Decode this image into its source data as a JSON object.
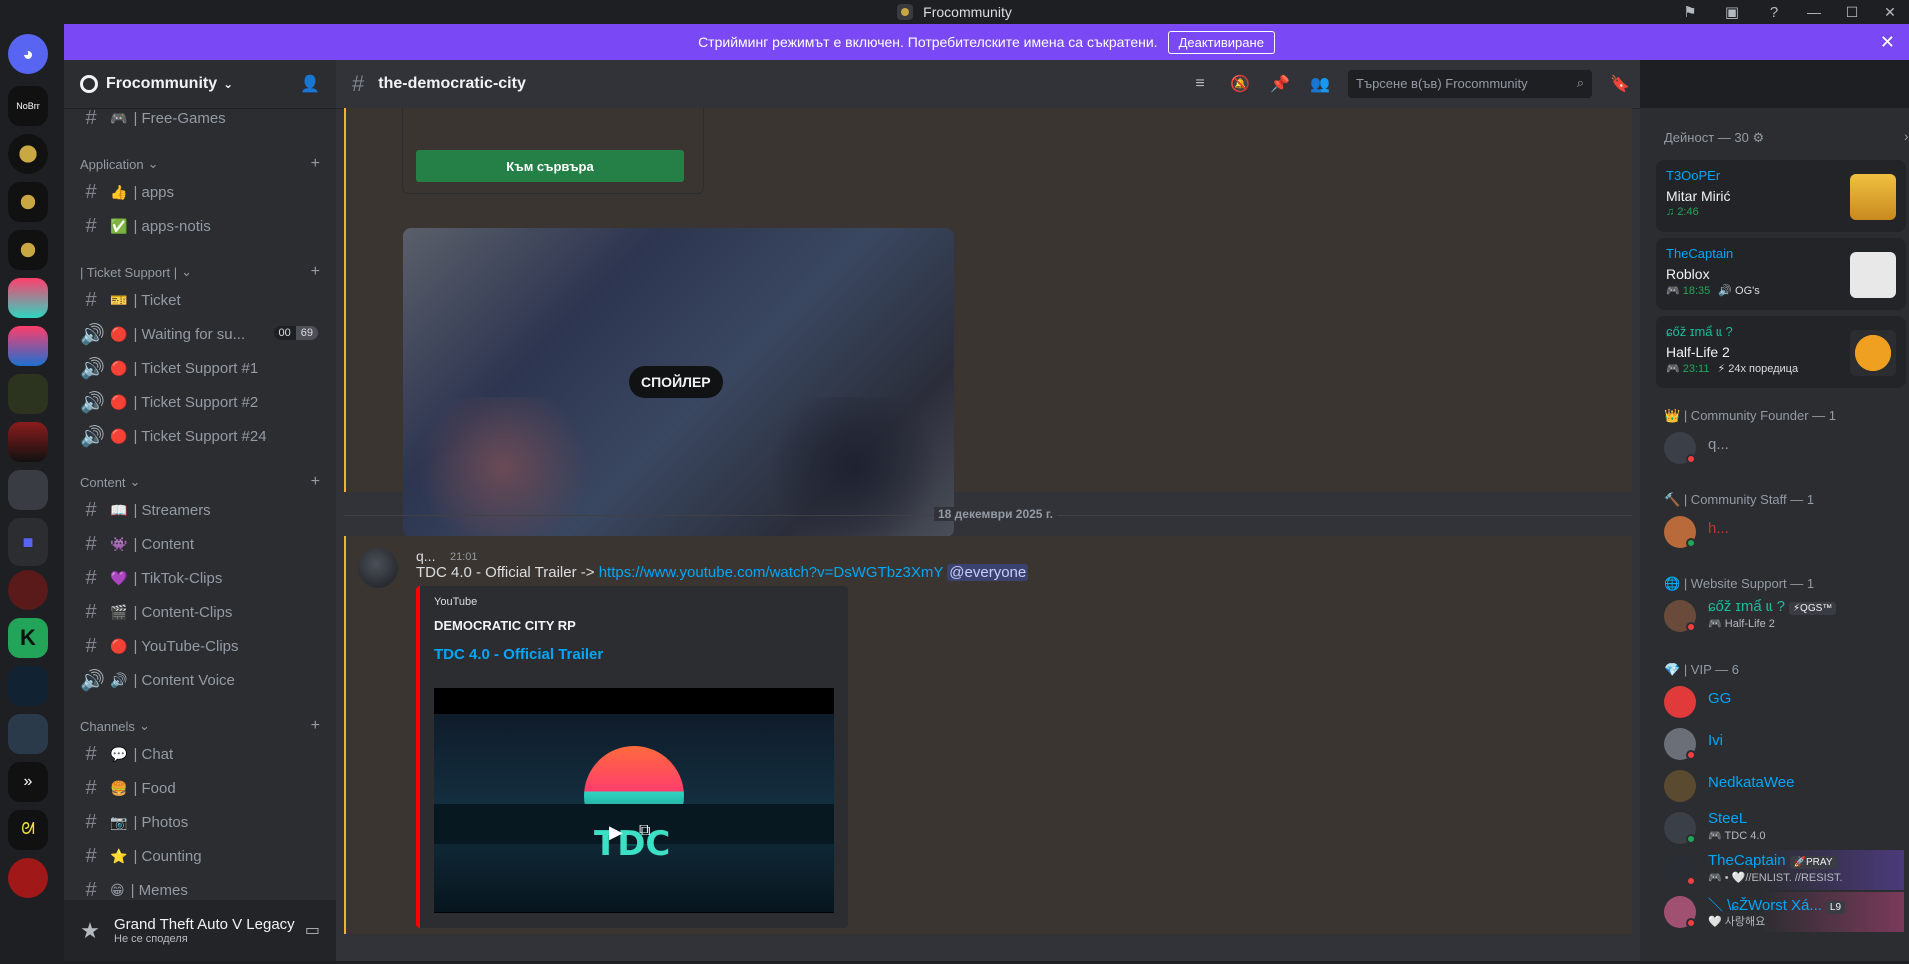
{
  "window": {
    "title": "Frocommunity"
  },
  "banner": {
    "text": "Стрийминг режимът е включен. Потребителските имена са съкратени.",
    "button": "Деактивиране"
  },
  "server": {
    "name": "Frocommunity"
  },
  "sidebar": {
    "channels_top": [
      {
        "emoji": "🎮",
        "label": "| Free-Games"
      }
    ],
    "categories": [
      {
        "name": "Application",
        "channels": [
          {
            "emoji": "👍",
            "label": "| apps"
          },
          {
            "emoji": "✅",
            "label": "| apps-notis"
          }
        ]
      },
      {
        "name": "| Ticket Support |",
        "channels": [
          {
            "emoji": "🎫",
            "label": "| Ticket"
          },
          {
            "emoji": "🔴",
            "label": "| Waiting for su...",
            "badge": [
              "00",
              "69"
            ]
          },
          {
            "emoji": "🔴",
            "label": "| Ticket Support #1"
          },
          {
            "emoji": "🔴",
            "label": "| Ticket Support #2"
          },
          {
            "emoji": "🔴",
            "label": "| Ticket Support #24"
          }
        ]
      },
      {
        "name": "Content",
        "channels": [
          {
            "emoji": "📖",
            "label": "| Streamers"
          },
          {
            "emoji": "👾",
            "label": "| Content"
          },
          {
            "emoji": "💜",
            "label": "| TikTok-Clips"
          },
          {
            "emoji": "🎬",
            "label": "| Content-Clips"
          },
          {
            "emoji": "🔴",
            "label": "| YouTube-Clips"
          },
          {
            "emoji": "🔊",
            "label": "| Content Voice"
          }
        ]
      },
      {
        "name": "Channels",
        "channels": [
          {
            "emoji": "💬",
            "label": "| Chat"
          },
          {
            "emoji": "🍔",
            "label": "| Food"
          },
          {
            "emoji": "📷",
            "label": "| Photos"
          },
          {
            "emoji": "⭐",
            "label": "| Counting"
          },
          {
            "emoji": "😁",
            "label": "| Memes"
          }
        ]
      }
    ]
  },
  "user_panel": {
    "activity": "Grand Theft Auto V Legacy",
    "status": "Не се споделя"
  },
  "chat": {
    "channel": "the-democratic-city",
    "search_placeholder": "Търсене в(ъв) Frocommunity",
    "server_button": "Към сървъра",
    "spoiler_label": "СПОЙЛЕР",
    "date_divider": "18 декември 2025 г.",
    "message": {
      "author": "q...",
      "time": "21:01",
      "text": "TDC 4.0 - Official Trailer -> ",
      "link": "https://www.youtube.com/watch?v=DsWGTbz3XmY",
      "mention": "@everyone"
    },
    "embed": {
      "provider": "YouTube",
      "author": "DEMOCRATIC CITY RP",
      "title": "TDC 4.0 - Official Trailer",
      "thumb_text": "TDC"
    }
  },
  "members": {
    "activity_header": "Дейност — 30",
    "activities": [
      {
        "user": "T3OoPEr",
        "title": "Mitar Mirić",
        "meta": "♫ 2:46",
        "sub": ""
      },
      {
        "user": "TheCaptain",
        "title": "Roblox",
        "meta": "🎮 18:35",
        "sub": "🔊 OG's"
      },
      {
        "user": "ɕőž ɪmẩ ɩɩ ?",
        "title": "Half-Life 2",
        "meta": "🎮 23:11",
        "sub": "⚡ 24x поредица"
      }
    ],
    "roles": [
      {
        "name": "| Community Founder — 1",
        "members": [
          {
            "name": "q...",
            "color": "#949ba4"
          }
        ]
      },
      {
        "name": "| Community Staff — 1",
        "members": [
          {
            "name": "h...",
            "color": "#c0392b"
          }
        ]
      },
      {
        "name": "| Website Support — 1",
        "members": [
          {
            "name": "ɕőž ɪmẩ ɩɩ ?",
            "tag": "⚡QGS™",
            "sub": "🎮 Half-Life 2",
            "color": "#1abc9c"
          }
        ]
      },
      {
        "name": "| VIP — 6",
        "members": [
          {
            "name": "GG",
            "color": "#00a8fc"
          },
          {
            "name": "Ivi",
            "color": "#00a8fc"
          },
          {
            "name": "NedkataWee",
            "color": "#00a8fc"
          },
          {
            "name": "SteeL",
            "sub": "🎮 TDC 4.0",
            "color": "#00a8fc"
          },
          {
            "name": "TheCaptain",
            "tag": "🚀PRAY",
            "sub": "🎮 • 🤍//ENLIST. //RESIST.",
            "color": "#00a8fc"
          },
          {
            "name": "＼ \\ɕŽWorst Xá...",
            "tag": "L9",
            "sub": "🤍 사랑해요",
            "color": "#00a8fc"
          }
        ]
      }
    ]
  }
}
